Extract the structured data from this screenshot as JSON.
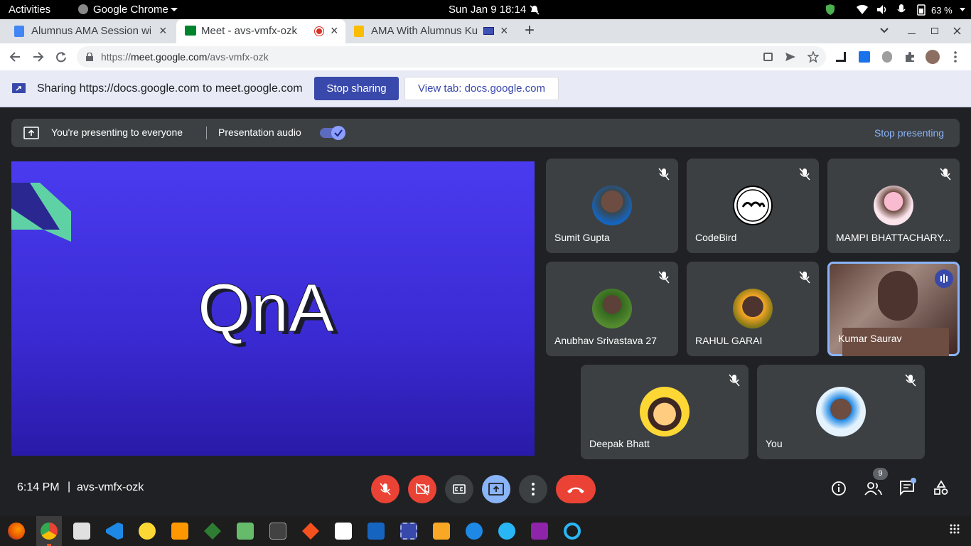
{
  "system_bar": {
    "activities": "Activities",
    "app_name": "Google Chrome",
    "clock": "Sun Jan 9  18:14",
    "battery": "63 %"
  },
  "tabs": [
    {
      "label": "Alumnus AMA Session wi",
      "close": "×"
    },
    {
      "label": "Meet - avs-vmfx-ozk",
      "close": "×"
    },
    {
      "label": "AMA With Alumnus Ku",
      "close": "×"
    }
  ],
  "new_tab": "+",
  "address": {
    "scheme": "https://",
    "host": "meet.google.com",
    "path": "/avs-vmfx-ozk"
  },
  "share_bar": {
    "text": "Sharing https://docs.google.com to meet.google.com",
    "stop_button": "Stop sharing",
    "view_button": "View tab: docs.google.com"
  },
  "presenting_bar": {
    "status": "You're presenting to everyone",
    "audio_label": "Presentation audio",
    "audio_on": true,
    "stop": "Stop presenting"
  },
  "slide": {
    "title": "QnA"
  },
  "participants": [
    {
      "name": "Sumit Gupta",
      "muted": true
    },
    {
      "name": "CodeBird",
      "muted": true
    },
    {
      "name": "MAMPI BHATTACHARY...",
      "muted": true
    },
    {
      "name": "Anubhav Srivastava 27",
      "muted": true
    },
    {
      "name": "RAHUL GARAI",
      "muted": true
    },
    {
      "name": "Kumar Saurav",
      "muted": false,
      "speaking": true
    },
    {
      "name": "Deepak Bhatt",
      "muted": true
    },
    {
      "name": "You",
      "muted": true
    }
  ],
  "footer": {
    "time": "6:14 PM",
    "separator": "|",
    "meeting_code": "avs-vmfx-ozk",
    "people_count": "9"
  },
  "colors": {
    "accent": "#3949ab",
    "danger": "#ea4335",
    "meet_bg": "#202124",
    "tile_bg": "#3c4043",
    "slide_top": "#4a3bf0",
    "slide_bottom": "#2a1aa8"
  }
}
